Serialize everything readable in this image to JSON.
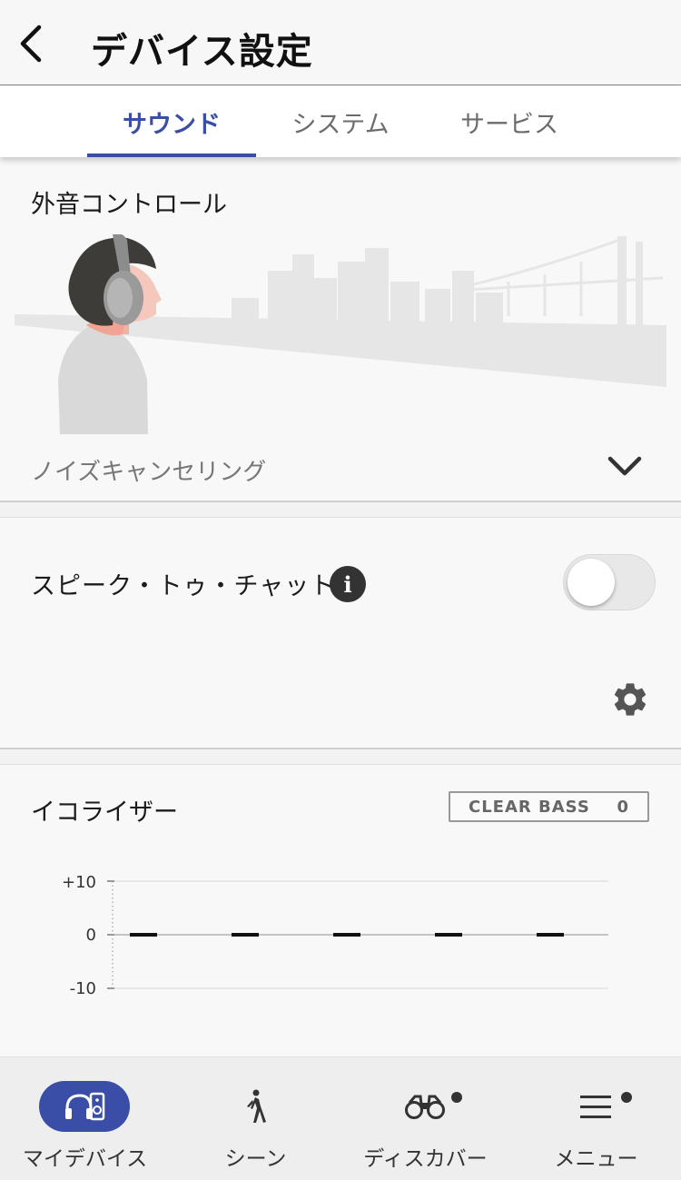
{
  "header": {
    "back_icon": "chevron-left-icon",
    "title": "デバイス設定"
  },
  "tabs": [
    {
      "label": "サウンド",
      "active": true
    },
    {
      "label": "システム",
      "active": false
    },
    {
      "label": "サービス",
      "active": false
    }
  ],
  "ambient_sound": {
    "title": "外音コントロール",
    "mode": "ノイズキャンセリング",
    "expand_icon": "chevron-down-icon"
  },
  "speak_to_chat": {
    "label": "スピーク・トゥ・チャット",
    "info_icon": "info-icon",
    "enabled": false,
    "settings_icon": "gear-icon"
  },
  "equalizer": {
    "title": "イコライザー",
    "clear_bass_label": "CLEAR BASS",
    "clear_bass_value": "0",
    "axis_labels": [
      "+10",
      "0",
      "-10"
    ],
    "band_values": [
      0,
      0,
      0,
      0,
      0
    ]
  },
  "bottom_nav": [
    {
      "label": "マイデバイス",
      "icon": "headphones-speaker-icon",
      "active": true,
      "badge": false
    },
    {
      "label": "シーン",
      "icon": "walking-person-icon",
      "active": false,
      "badge": false
    },
    {
      "label": "ディスカバー",
      "icon": "binoculars-icon",
      "active": false,
      "badge": true
    },
    {
      "label": "メニュー",
      "icon": "hamburger-menu-icon",
      "active": false,
      "badge": true
    }
  ],
  "colors": {
    "accent": "#3a4ea8",
    "background": "#f8f8f8"
  }
}
